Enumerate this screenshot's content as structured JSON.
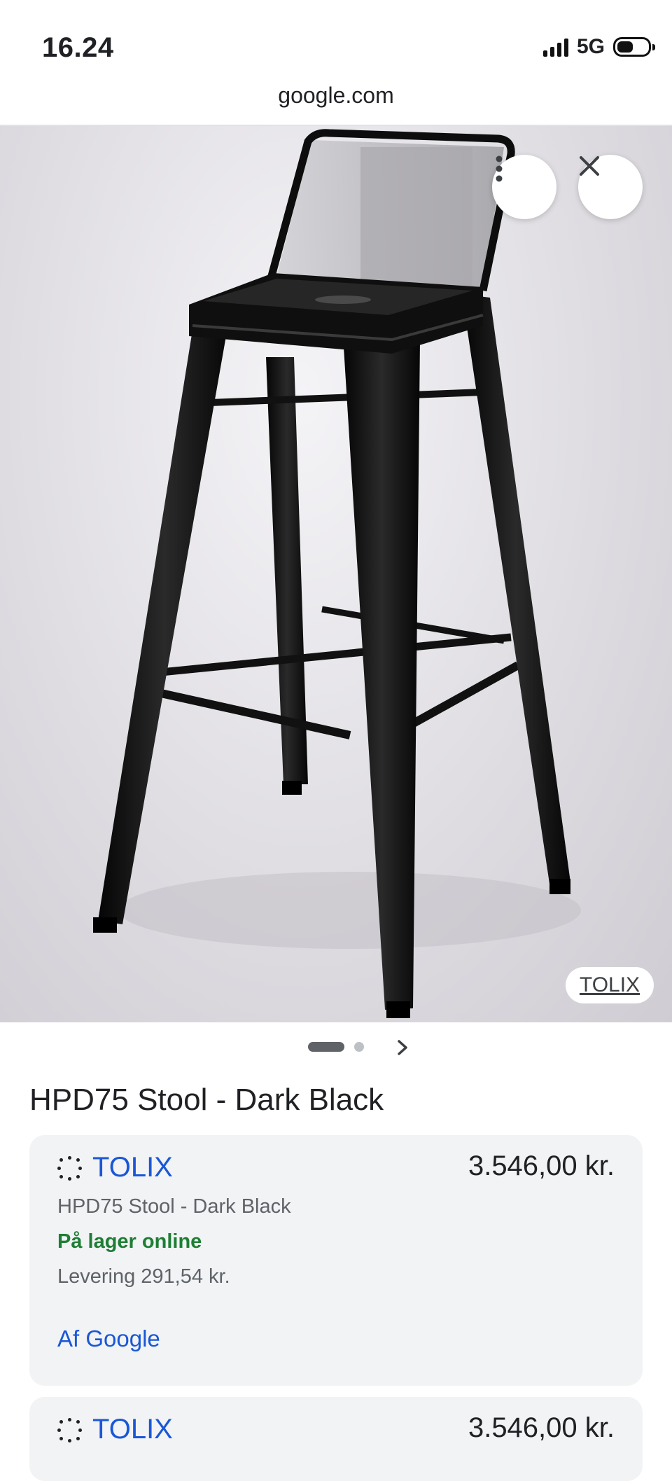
{
  "status_bar": {
    "time": "16.24",
    "network": "5G"
  },
  "url_bar": {
    "domain": "google.com"
  },
  "image_viewer": {
    "source_label": "TOLIX",
    "icons": [
      "more-vert-icon",
      "close-icon"
    ],
    "pager": {
      "active_index": 0,
      "count": 2
    }
  },
  "product": {
    "title": "HPD75 Stool - Dark Black"
  },
  "offers": [
    {
      "merchant": "TOLIX",
      "price": "3.546,00 kr.",
      "subtitle": "HPD75 Stool - Dark Black",
      "stock": "På lager online",
      "delivery": "Levering 291,54 kr.",
      "link": "Af Google"
    },
    {
      "merchant": "TOLIX",
      "price": "3.546,00 kr."
    }
  ],
  "colors": {
    "link_blue": "#1a57d6",
    "stock_green": "#1e7e34",
    "card_bg": "#f1f3f4"
  }
}
